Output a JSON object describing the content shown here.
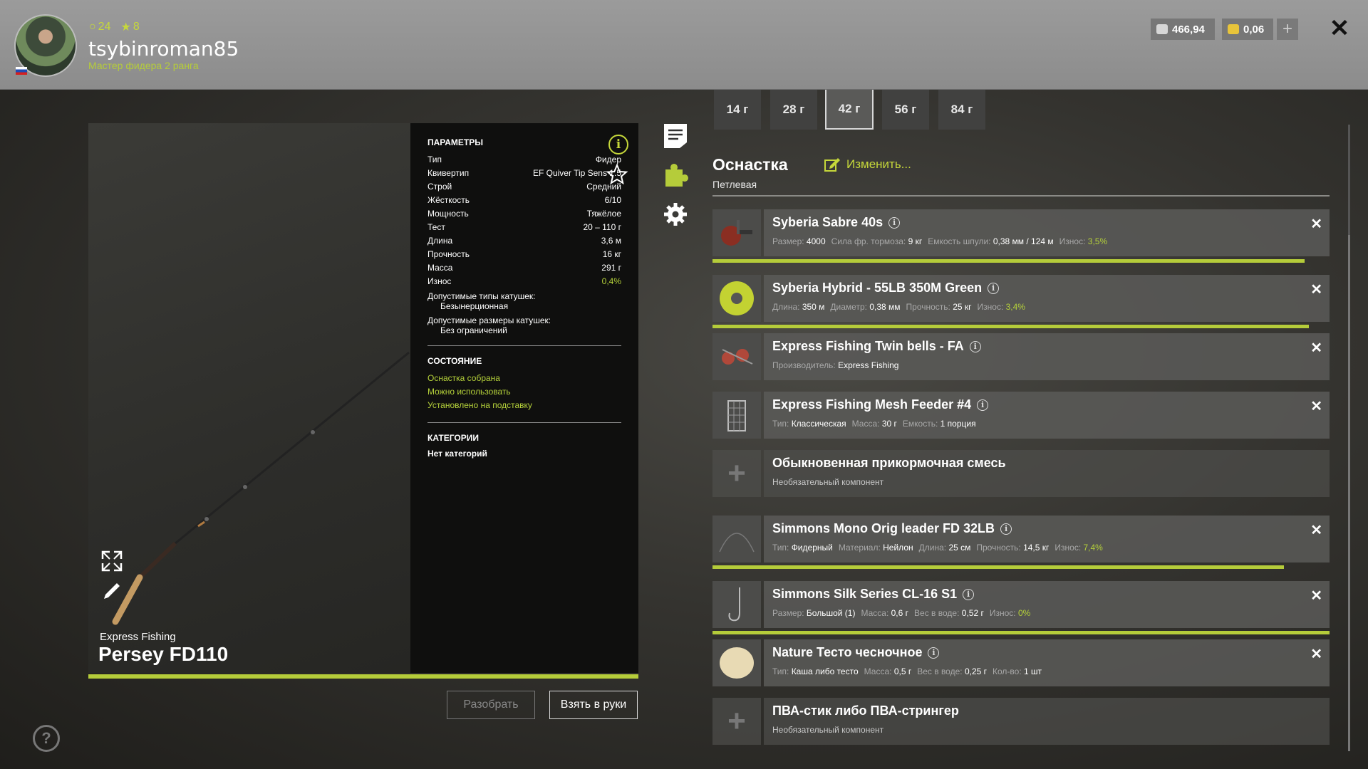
{
  "header": {
    "level": "24",
    "stars": "8",
    "username": "tsybinroman85",
    "rank": "Мастер фидера 2 ранга",
    "silver": "466,94",
    "gold": "0,06",
    "plus_icon": "plus-icon",
    "close_icon": "close-icon"
  },
  "rod": {
    "brand": "Express Fishing",
    "name": "Persey FD110"
  },
  "params": {
    "title": "ПАРАМЕТРЫ",
    "rows": [
      {
        "label": "Тип",
        "value": "Фидер"
      },
      {
        "label": "Квивертип",
        "value": "EF Quiver Tip Sens 1.5"
      },
      {
        "label": "Строй",
        "value": "Средний"
      },
      {
        "label": "Жёсткость",
        "value": "6/10"
      },
      {
        "label": "Мощность",
        "value": "Тяжёлое"
      },
      {
        "label": "Тест",
        "value": "20 – 110 г"
      },
      {
        "label": "Длина",
        "value": "3,6 м"
      },
      {
        "label": "Прочность",
        "value": "16 кг"
      },
      {
        "label": "Масса",
        "value": "291 г"
      },
      {
        "label": "Износ",
        "value": "0,4%"
      }
    ],
    "reel_types_label": "Допустимые типы катушек:",
    "reel_types_value": "Безынерционная",
    "reel_sizes_label": "Допустимые размеры катушек:",
    "reel_sizes_value": "Без ограничений",
    "state_title": "СОСТОЯНИЕ",
    "states": [
      "Оснастка собрана",
      "Можно использовать",
      "Установлено на подставку"
    ],
    "cat_title": "КАТЕГОРИИ",
    "cat_value": "Нет категорий"
  },
  "buttons": {
    "disassemble": "Разобрать",
    "take": "Взять в руки"
  },
  "weights": [
    "14 г",
    "28 г",
    "42 г",
    "56 г",
    "84 г"
  ],
  "weight_selected": "42 г",
  "rig": {
    "title": "Оснастка",
    "subtitle": "Петлевая",
    "edit": "Изменить..."
  },
  "items": [
    {
      "name": "Syberia Sabre 40s",
      "details": [
        [
          "Размер:",
          "4000"
        ],
        [
          "Сила фр. тормоза:",
          "9 кг"
        ],
        [
          "Емкость шпули:",
          "0,38 мм / 124 м"
        ],
        [
          "Износ:",
          "3,5%"
        ]
      ],
      "bar": 0.96
    },
    {
      "name": "Syberia Hybrid - 55LB 350M Green",
      "details": [
        [
          "Длина:",
          "350 м"
        ],
        [
          "Диаметр:",
          "0,38 мм"
        ],
        [
          "Прочность:",
          "25 кг"
        ],
        [
          "Износ:",
          "3,4%"
        ]
      ],
      "bar": 0.966
    },
    {
      "name": "Express Fishing Twin bells - FA",
      "details": [
        [
          "Производитель:",
          "Express Fishing"
        ]
      ]
    },
    {
      "name": "Express Fishing Mesh Feeder #4",
      "details": [
        [
          "Тип:",
          "Классическая"
        ],
        [
          "Масса:",
          "30 г"
        ],
        [
          "Емкость:",
          "1 порция"
        ]
      ]
    },
    {
      "name": "Обыкновенная прикормочная смесь",
      "optional": "Необязательный компонент"
    },
    {
      "name": "Simmons Mono Orig leader FD 32LB",
      "details": [
        [
          "Тип:",
          "Фидерный"
        ],
        [
          "Материал:",
          "Нейлон"
        ],
        [
          "Длина:",
          "25 см"
        ],
        [
          "Прочность:",
          "14,5 кг"
        ],
        [
          "Износ:",
          "7,4%"
        ]
      ],
      "bar": 0.926
    },
    {
      "name": "Simmons Silk Series CL-16 S1",
      "details": [
        [
          "Размер:",
          "Большой (1)"
        ],
        [
          "Масса:",
          "0,6 г"
        ],
        [
          "Вес в воде:",
          "0,52 г"
        ],
        [
          "Износ:",
          "0%"
        ]
      ],
      "bar": 1.0
    },
    {
      "name": "Nature Тесто чесночное",
      "details": [
        [
          "Тип:",
          "Каша либо тесто"
        ],
        [
          "Масса:",
          "0,5 г"
        ],
        [
          "Вес в воде:",
          "0,25 г"
        ],
        [
          "Кол-во:",
          "1 шт"
        ]
      ]
    },
    {
      "name": "ПВА-стик либо ПВА-стрингер",
      "optional": "Необязательный компонент"
    }
  ],
  "colors": {
    "accent": "#b5cc3a",
    "panel": "#0f0f0e"
  }
}
